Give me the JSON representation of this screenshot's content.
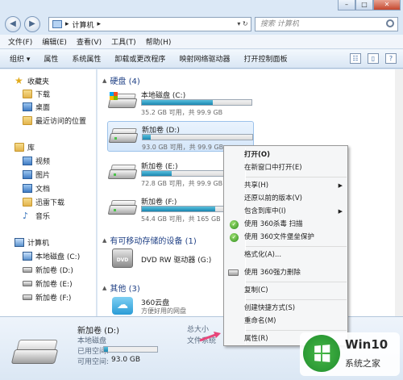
{
  "window": {
    "buttons": [
      "–",
      "□",
      "✕"
    ]
  },
  "address": {
    "path_root": "▸",
    "path": "计算机",
    "path_arrow": "▸",
    "search_placeholder": "搜索 计算机"
  },
  "menubar": [
    "文件(F)",
    "编辑(E)",
    "查看(V)",
    "工具(T)",
    "帮助(H)"
  ],
  "toolbar": [
    "组织 ▾",
    "属性",
    "系统属性",
    "卸载或更改程序",
    "映射网络驱动器",
    "打开控制面板"
  ],
  "sidebar": {
    "favorites_label": "收藏夹",
    "favorites": [
      "下载",
      "桌面",
      "最近访问的位置"
    ],
    "libraries_label": "库",
    "libraries": [
      "视频",
      "图片",
      "文档",
      "迅雷下载",
      "音乐"
    ],
    "computer_label": "计算机",
    "drives": [
      "本地磁盘 (C:)",
      "新加卷 (D:)",
      "新加卷 (E:)",
      "新加卷 (F:)"
    ]
  },
  "main": {
    "group_hdd": "硬盘 (4)",
    "drives": [
      {
        "name": "本地磁盘 (C:)",
        "free": "35.2 GB 可用，共 99.9 GB",
        "used_fraction": 0.65
      },
      {
        "name": "新加卷 (D:)",
        "free": "93.0 GB 可用，共 99.9 GB",
        "used_fraction": 0.07
      },
      {
        "name": "新加卷 (E:)",
        "free": "72.8 GB 可用，共 99.9 GB",
        "used_fraction": 0.27
      },
      {
        "name": "新加卷 (F:)",
        "free": "54.4 GB 可用，共 165 GB",
        "used_fraction": 0.67
      }
    ],
    "group_removable": "有可移动存储的设备 (1)",
    "dvd_name": "DVD RW 驱动器 (G:)",
    "group_other": "其他 (3)",
    "cloud_name": "360云盘",
    "cloud_desc": "方便好用的网盘"
  },
  "context_menu": {
    "open": "打开(O)",
    "open_new": "在新窗口中打开(E)",
    "share": "共享(H)",
    "restore": "还原以前的版本(V)",
    "include": "包含到库中(I)",
    "scan360": "使用 360杀毒 扫描",
    "vault360": "使用 360文件堡垒保护",
    "format": "格式化(A)...",
    "force_delete": "使用 360强力删除",
    "copy": "复制(C)",
    "shortcut": "创建快捷方式(S)",
    "rename": "重命名(M)",
    "properties": "属性(R)"
  },
  "details": {
    "name": "新加卷 (D:)",
    "type": "本地磁盘",
    "used_label": "已用空间:",
    "free_label": "可用空间:",
    "free_value": "93.0 GB",
    "total_label": "总大小",
    "fs_label": "文件系统",
    "used_fraction": 0.07
  },
  "watermark": {
    "title": "Win10",
    "subtitle": "系统之家"
  }
}
